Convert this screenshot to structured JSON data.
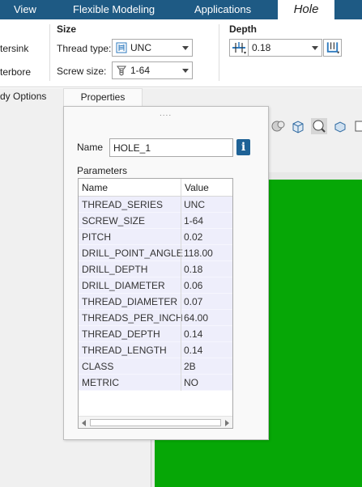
{
  "menu": {
    "items": [
      "View",
      "Flexible Modeling",
      "Applications"
    ],
    "active_item": "Hole"
  },
  "ribbon": {
    "left_options": [
      "tersink",
      "terbore"
    ],
    "size_group": {
      "title": "Size",
      "thread_type_label": "Thread type:",
      "thread_type_value": "UNC",
      "screw_size_label": "Screw size:",
      "screw_size_value": "1-64"
    },
    "depth_group": {
      "title": "Depth",
      "depth_value": "0.18"
    }
  },
  "tabs": {
    "body_options": "dy Options",
    "properties": "Properties"
  },
  "properties_panel": {
    "grip": "....",
    "name_label": "Name",
    "name_value": "HOLE_1",
    "info_button": "i",
    "parameters_label": "Parameters",
    "columns": [
      "Name",
      "Value"
    ],
    "rows": [
      {
        "name": "THREAD_SERIES",
        "value": "UNC"
      },
      {
        "name": "SCREW_SIZE",
        "value": "1-64"
      },
      {
        "name": "PITCH",
        "value": "0.02"
      },
      {
        "name": "DRILL_POINT_ANGLE",
        "value": "118.00"
      },
      {
        "name": "DRILL_DEPTH",
        "value": "0.18"
      },
      {
        "name": "DRILL_DIAMETER",
        "value": "0.06"
      },
      {
        "name": "THREAD_DIAMETER",
        "value": "0.07"
      },
      {
        "name": "THREADS_PER_INCH",
        "value": "64.00"
      },
      {
        "name": "THREAD_DEPTH",
        "value": "0.14"
      },
      {
        "name": "THREAD_LENGTH",
        "value": "0.14"
      },
      {
        "name": "CLASS",
        "value": "2B"
      },
      {
        "name": "METRIC",
        "value": "NO"
      }
    ]
  },
  "colors": {
    "menubar": "#1e5a84",
    "viewport": "#06a706",
    "row_bg": "#eeeefb",
    "info_button": "#1e6296"
  },
  "icons": [
    "thread-type-icon",
    "screw-icon",
    "depth-blind-icon",
    "depth-options-icon",
    "sphere-icon",
    "cube-icon",
    "hole-view-icon",
    "display-icon",
    "more-icon"
  ]
}
